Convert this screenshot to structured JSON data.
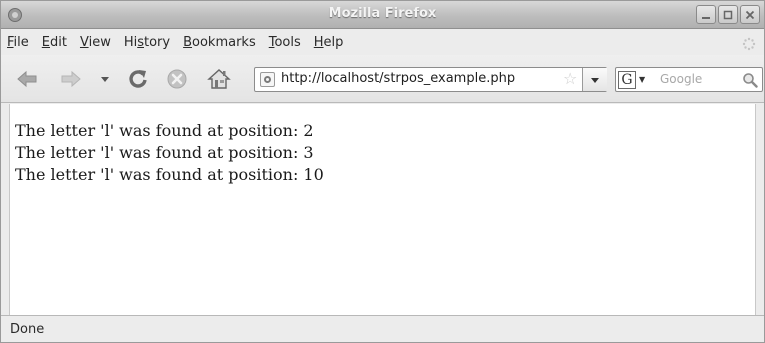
{
  "window": {
    "title": "Mozilla Firefox"
  },
  "menubar": {
    "items": [
      {
        "label": "File",
        "accel": "F",
        "rest": "ile"
      },
      {
        "label": "Edit",
        "accel": "E",
        "rest": "dit"
      },
      {
        "label": "View",
        "accel": "V",
        "rest": "iew"
      },
      {
        "label": "History",
        "accel": "s",
        "pre": "Hi",
        "rest": "tory"
      },
      {
        "label": "Bookmarks",
        "accel": "B",
        "rest": "ookmarks"
      },
      {
        "label": "Tools",
        "accel": "T",
        "rest": "ools"
      },
      {
        "label": "Help",
        "accel": "H",
        "rest": "elp"
      }
    ]
  },
  "navbar": {
    "url": "http://localhost/strpos_example.php",
    "search_engine": "G",
    "search_placeholder": "Google"
  },
  "content": {
    "lines": [
      "The letter 'l' was found at position: 2",
      "The letter 'l' was found at position: 3",
      "The letter 'l' was found at position: 10"
    ]
  },
  "statusbar": {
    "text": "Done"
  },
  "icons": {
    "back": "back-arrow-icon",
    "forward": "forward-arrow-icon",
    "history_dropdown": "chevron-down-icon",
    "reload": "reload-icon",
    "stop": "stop-icon",
    "home": "home-icon",
    "bookmark_star": "star-icon",
    "search_go": "magnifier-icon"
  }
}
